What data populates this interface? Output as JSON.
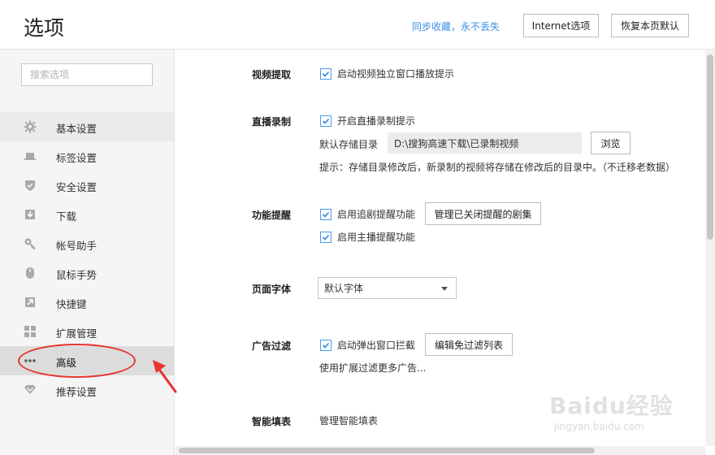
{
  "header": {
    "title": "选项",
    "sync_link": "同步收藏，永不丢失",
    "internet_button": "Internet选项",
    "restore_button": "恢复本页默认"
  },
  "sidebar": {
    "search_placeholder": "搜索选项",
    "items": [
      {
        "label": "基本设置",
        "icon": "gear-icon"
      },
      {
        "label": "标签设置",
        "icon": "tab-icon"
      },
      {
        "label": "安全设置",
        "icon": "shield-icon"
      },
      {
        "label": "下载",
        "icon": "download-icon"
      },
      {
        "label": "帐号助手",
        "icon": "key-icon"
      },
      {
        "label": "鼠标手势",
        "icon": "mouse-icon"
      },
      {
        "label": "快捷键",
        "icon": "shortcut-icon"
      },
      {
        "label": "扩展管理",
        "icon": "extensions-icon"
      },
      {
        "label": "高级",
        "icon": "more-dots-icon"
      },
      {
        "label": "推荐设置",
        "icon": "recommend-icon"
      }
    ],
    "active_item": "高级",
    "hover_item": "基本设置"
  },
  "content": {
    "video": {
      "label": "视频提取",
      "option": "启动视频独立窗口播放提示",
      "checked": true
    },
    "live": {
      "label": "直播录制",
      "option": "开启直播录制提示",
      "checked": true,
      "dir_label": "默认存储目录",
      "dir_value": "D:\\搜狗高速下载\\已录制视频",
      "browse_button": "浏览",
      "hint": "提示：存储目录修改后，新录制的视频将存储在修改后的目录中。（不迁移老数据）"
    },
    "reminder": {
      "label": "功能提醒",
      "option1": "启用追剧提醒功能",
      "option1_checked": true,
      "manage_button": "管理已关闭提醒的剧集",
      "option2": "启用主播提醒功能",
      "option2_checked": true
    },
    "font": {
      "label": "页面字体",
      "selected": "默认字体"
    },
    "adblock": {
      "label": "广告过滤",
      "option": "启动弹出窗口拦截",
      "checked": true,
      "edit_button": "编辑免过滤列表",
      "more": "使用扩展过滤更多广告..."
    },
    "autofill": {
      "label": "智能填表",
      "link": "管理智能填表"
    }
  },
  "watermark": {
    "logo": "Baidu经验",
    "url": "jingyan.baidu.com"
  },
  "colors": {
    "accent": "#3a8ee6",
    "annotation": "#e8322e",
    "sidebar_bg": "#f5f5f5",
    "active_bg": "#dcdcdc"
  }
}
